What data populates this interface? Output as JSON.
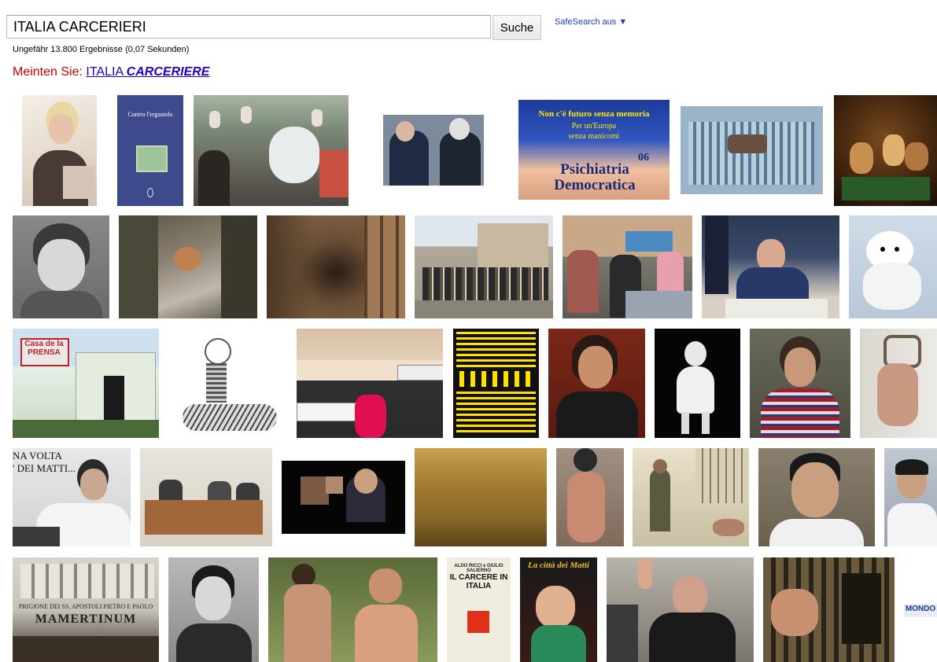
{
  "search": {
    "query": "ITALIA CARCERIERI",
    "button_label": "Suche"
  },
  "safesearch": {
    "label": "SafeSearch aus ▼"
  },
  "stats": {
    "text": "Ungefähr 13.800 Ergebnisse (0,07 Sekunden)"
  },
  "suggestion": {
    "prefix": "Meinten Sie:",
    "plain": "ITALIA ",
    "bold": "CARCERIERE"
  },
  "images": {
    "book1": {
      "title": "Contro l'ergastolo"
    },
    "banner": {
      "line1": "Non c'è futuro senza memoria",
      "line2": "Per un'Europa",
      "line3": "senza manicomi",
      "number": "06",
      "brand1": "Psichiatria",
      "brand2": "Democratica"
    },
    "sign": {
      "text": "Casa de la PRENSA"
    },
    "pagemarker": {
      "text": "NA VOLTA\n' DEI MATTI..."
    },
    "mamertinum": {
      "line1": "PRIGIONE DEI SS. APOSTOLI PIETRO E PAOLO",
      "line2": "MAMERTINUM"
    },
    "book2": {
      "authors": "ALDO RICCI e GIULIO SALIERNO",
      "title": "IL CARCERE IN ITALIA"
    },
    "comic": {
      "title": "La città dei Matti"
    },
    "mondo": {
      "text": "MONDO"
    }
  }
}
